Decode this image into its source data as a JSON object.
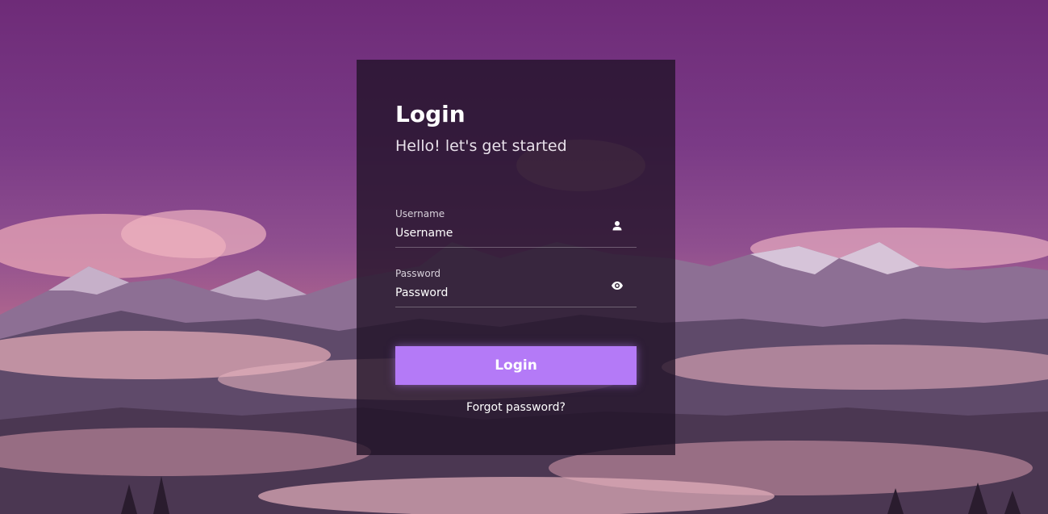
{
  "login": {
    "title": "Login",
    "subtitle": "Hello! let's get started",
    "username_label": "Username",
    "username_placeholder": "Username",
    "password_label": "Password",
    "password_placeholder": "Password",
    "submit_label": "Login",
    "forgot_link": "Forgot password?"
  },
  "icons": {
    "username": "user-icon",
    "password": "eye-icon"
  },
  "colors": {
    "button": "#b47af7",
    "card": "#201226",
    "text": "#ffffff"
  }
}
